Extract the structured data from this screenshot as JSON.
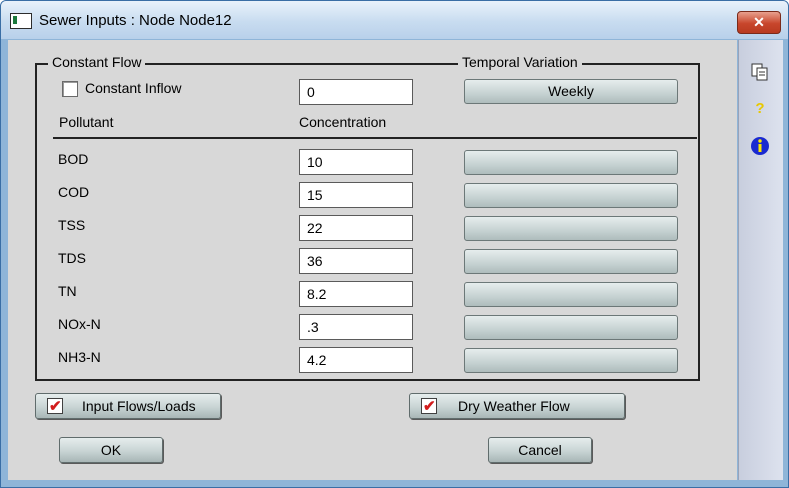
{
  "window": {
    "title": "Sewer Inputs : Node Node12",
    "close_label": "✕"
  },
  "constant_flow": {
    "legend": "Constant Flow",
    "checkbox_label": "Constant Inflow",
    "checked": false,
    "inflow_value": "0"
  },
  "temporal_variation": {
    "legend": "Temporal Variation",
    "button_label": "Weekly"
  },
  "headers": {
    "pollutant": "Pollutant",
    "concentration": "Concentration"
  },
  "pollutants": [
    {
      "name": "BOD",
      "value": "10"
    },
    {
      "name": "COD",
      "value": "15"
    },
    {
      "name": "TSS",
      "value": "22"
    },
    {
      "name": "TDS",
      "value": "36"
    },
    {
      "name": "TN",
      "value": "8.2"
    },
    {
      "name": "NOx-N",
      "value": ".3"
    },
    {
      "name": "NH3-N",
      "value": "4.2"
    }
  ],
  "buttons": {
    "input_flows": "Input Flows/Loads",
    "input_flows_checked": true,
    "dry_weather": "Dry Weather Flow",
    "dry_weather_checked": true,
    "ok": "OK",
    "cancel": "Cancel"
  },
  "sidebar": {
    "icons": [
      "copy-icon",
      "help-icon",
      "info-icon"
    ]
  },
  "colors": {
    "title_bar": "#c8dcf0",
    "close_button": "#c8462c",
    "dialog_bg": "#d8d8d8",
    "check_mark": "#d21c1c"
  }
}
